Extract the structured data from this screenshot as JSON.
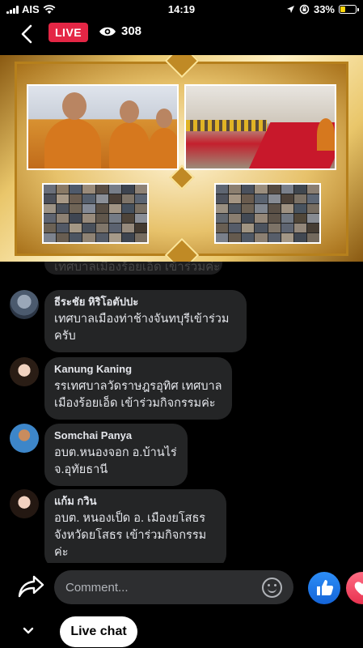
{
  "status_bar": {
    "carrier": "AIS",
    "time": "14:19",
    "battery": "33%",
    "battery_level": 0.33
  },
  "top_bar": {
    "live_label": "LIVE",
    "viewer_count": "308"
  },
  "comments": [
    {
      "text": "เทศบาลเมืองร้อยเอ็ด เข้าร่วมค่ะ"
    },
    {
      "name": "ธีระชัย หิริโอตัปปะ",
      "lines": [
        "เทศบาลเมืองท่าช้างจันทบุรีเข้าร่วม",
        "ครับ"
      ]
    },
    {
      "name": "Kanung Kaning",
      "lines": [
        "รรเทศบาลวัดราษฎรอุทิศ เทศบาล",
        "เมืองร้อยเอ็ด เข้าร่วมกิจกรรมค่ะ"
      ]
    },
    {
      "name": "Somchai Panya",
      "lines": [
        "อบต.หนองจอก อ.บ้านไร่",
        "จ.อุทัยธานี"
      ]
    },
    {
      "name": "แก้ม กวิน",
      "lines": [
        "อบต. หนองเป็ด อ. เมืองยโสธร",
        "จังหวัดยโสธร เข้าร่วมกิจกรรมค่ะ"
      ]
    }
  ],
  "composer": {
    "placeholder": "Comment..."
  },
  "bottom": {
    "live_chat_label": "Live chat"
  },
  "colors": {
    "live_red": "#e42645",
    "bubble": "#242526",
    "like_blue": "#1877f2",
    "love_red": "#f33e58"
  },
  "icons": [
    "signal-icon",
    "wifi-icon",
    "location-icon",
    "orientation-lock-icon",
    "battery-icon",
    "back-icon",
    "eye-icon",
    "share-icon",
    "emoji-icon",
    "like-icon",
    "love-icon",
    "chevron-down-icon"
  ]
}
